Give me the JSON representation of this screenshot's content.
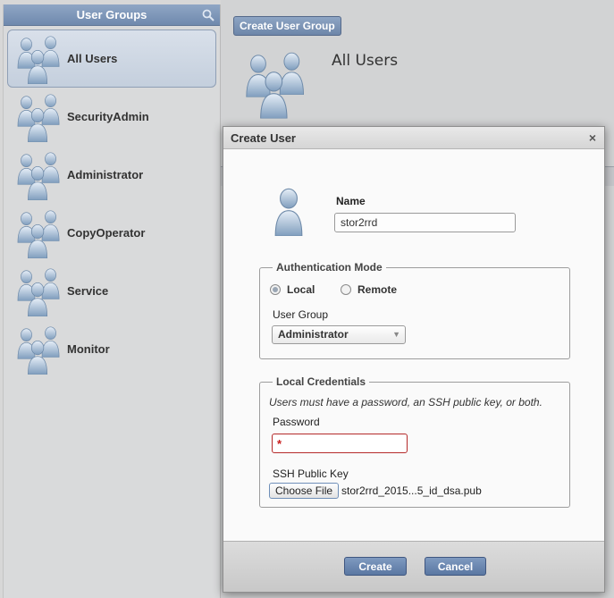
{
  "sidebar": {
    "title": "User Groups",
    "items": [
      {
        "label": "All Users",
        "selected": true
      },
      {
        "label": "SecurityAdmin",
        "selected": false
      },
      {
        "label": "Administrator",
        "selected": false
      },
      {
        "label": "CopyOperator",
        "selected": false
      },
      {
        "label": "Service",
        "selected": false
      },
      {
        "label": "Monitor",
        "selected": false
      }
    ]
  },
  "main": {
    "create_group_label": "Create User Group",
    "group_title": "All Users"
  },
  "dialog": {
    "title": "Create User",
    "close_glyph": "×",
    "name_label": "Name",
    "name_value": "stor2rrd",
    "auth_legend": "Authentication Mode",
    "auth_options": [
      {
        "label": "Local",
        "checked": true
      },
      {
        "label": "Remote",
        "checked": false
      }
    ],
    "user_group_label": "User Group",
    "user_group_value": "Administrator",
    "cred_legend": "Local Credentials",
    "cred_note": "Users must have a password, an SSH public key, or both.",
    "password_label": "Password",
    "password_required_mark": "*",
    "ssh_label": "SSH Public Key",
    "choose_file_label": "Choose File",
    "file_name": "stor2rrd_2015...5_id_dsa.pub",
    "create_label": "Create",
    "cancel_label": "Cancel"
  },
  "colors": {
    "header_blue": "#7b93b6",
    "required_red": "#b52a2a"
  }
}
